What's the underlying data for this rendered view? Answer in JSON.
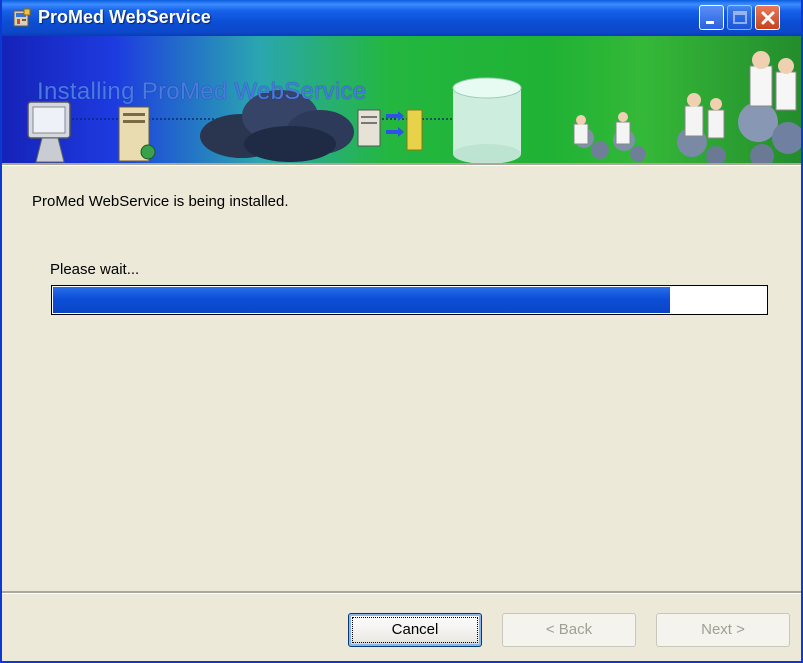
{
  "window": {
    "title": "ProMed WebService",
    "title_icon": "installer-icon"
  },
  "titlebar_buttons": {
    "minimize": "minimize-icon",
    "maximize": "maximize-icon",
    "close": "close-icon"
  },
  "banner": {
    "title": "Installing ProMed WebService"
  },
  "content": {
    "status_text": "ProMed WebService is being installed.",
    "wait_label": "Please wait...",
    "progress_fraction": 0.865
  },
  "footer": {
    "cancel_label": "Cancel",
    "back_label": "< Back",
    "next_label": "Next >"
  },
  "colors": {
    "titlebar": "#0b4fd6",
    "progress": "#0a4fd8",
    "dialog_bg": "#ece9d8"
  }
}
